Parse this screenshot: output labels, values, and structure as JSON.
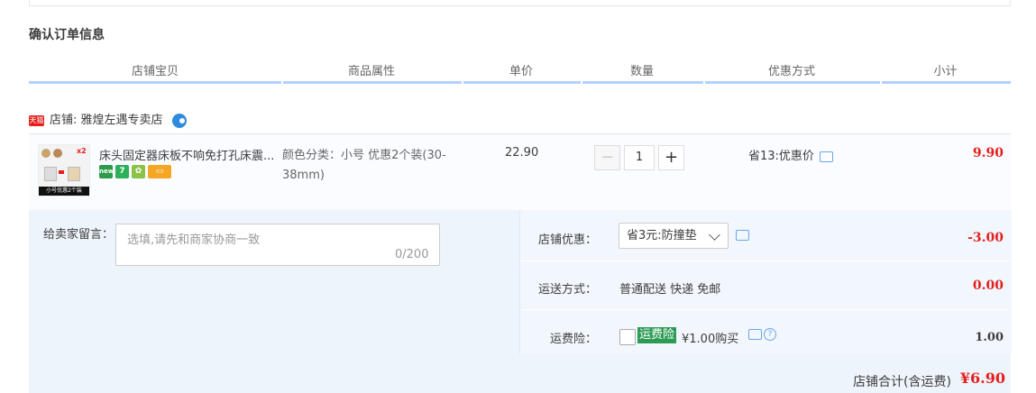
{
  "section_title": "确认订单信息",
  "columns": [
    "店铺宝贝",
    "商品属性",
    "单价",
    "数量",
    "优惠方式",
    "小计"
  ],
  "shop": {
    "badge": "天猫",
    "label": "店铺: 雅煌左遇专卖店"
  },
  "item": {
    "title": "床头固定器床板不响免打孔床震...",
    "thumb_badge": "x2",
    "thumb_caption": "小号优惠2个装",
    "attr": "颜色分类：小号 优惠2个装(30-38mm)",
    "price": "22.90",
    "qty_minus": "−",
    "qty": "1",
    "qty_plus": "+",
    "promo": "省13:优惠价",
    "subtotal": "9.90",
    "badges": [
      "new",
      "7",
      "✿",
      "▭"
    ]
  },
  "message": {
    "label": "给卖家留言：",
    "placeholder": "选填,请先和商家协商一致",
    "count": "0/200"
  },
  "shop_discount": {
    "label": "店铺优惠：",
    "selected": "省3元:防撞垫",
    "amount": "-3.00"
  },
  "shipping": {
    "label": "运送方式：",
    "value": "普通配送 快递 免邮",
    "amount": "0.00"
  },
  "insurance": {
    "label": "运费险：",
    "tag": "运费险",
    "value": "¥1.00购买",
    "help": "?",
    "amount": "1.00"
  },
  "total": {
    "label": "店铺合计(含运费)",
    "amount": "¥6.90"
  }
}
